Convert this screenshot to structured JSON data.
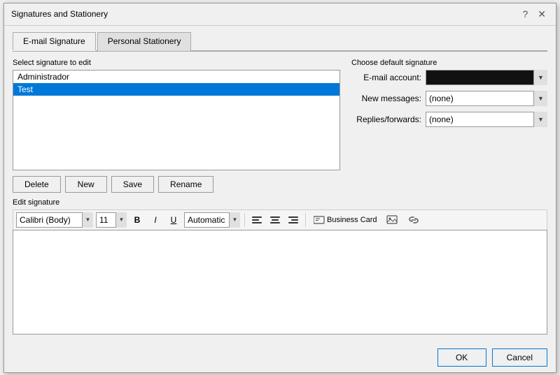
{
  "dialog": {
    "title": "Signatures and Stationery",
    "help_button": "?",
    "close_button": "✕"
  },
  "tabs": [
    {
      "id": "email-signature",
      "label": "E-mail Signature",
      "active": true
    },
    {
      "id": "personal-stationery",
      "label": "Personal Stationery",
      "active": false
    }
  ],
  "left_panel": {
    "section_label": "Select signature to edit",
    "signatures": [
      {
        "name": "Administrador",
        "selected": false
      },
      {
        "name": "Test",
        "selected": true
      }
    ],
    "buttons": {
      "delete": "Delete",
      "new": "New",
      "save": "Save",
      "rename": "Rename"
    }
  },
  "right_panel": {
    "section_label": "Choose default signature",
    "fields": {
      "email_account_label": "E-mail account:",
      "email_account_value": "",
      "new_messages_label": "New messages:",
      "new_messages_value": "(none)",
      "new_messages_options": [
        "(none)"
      ],
      "replies_forwards_label": "Replies/forwards:",
      "replies_forwards_value": "(none)",
      "replies_forwards_options": [
        "(none)"
      ]
    }
  },
  "edit_section": {
    "label": "Edit signature",
    "toolbar": {
      "font_name": "Calibri (Body)",
      "font_size": "11",
      "bold": "B",
      "italic": "I",
      "underline": "U",
      "color_label": "Automatic",
      "align_left": "left",
      "align_center": "center",
      "align_right": "right",
      "business_card": "Business Card",
      "insert_image_tooltip": "Insert Picture",
      "insert_link_tooltip": "Insert Hyperlink"
    },
    "content": ""
  },
  "footer": {
    "ok_label": "OK",
    "cancel_label": "Cancel"
  }
}
